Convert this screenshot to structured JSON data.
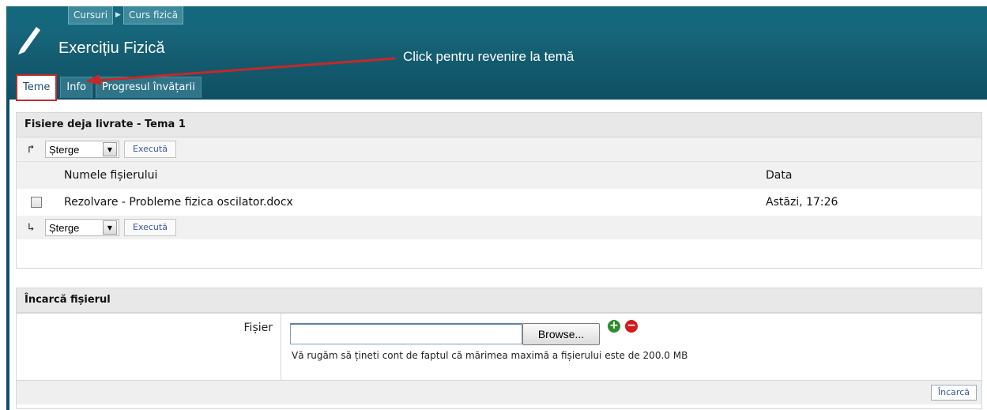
{
  "breadcrumb": [
    "Cursuri",
    "Curs fizică"
  ],
  "title": "Exercițiu Fizică",
  "annotation": "Click pentru revenire la temă",
  "tabs": [
    {
      "label": "Teme",
      "active": true
    },
    {
      "label": "Info",
      "active": false
    },
    {
      "label": "Progresul învățarii",
      "active": false
    }
  ],
  "delivered_panel": {
    "heading": "Fisiere deja livrate - Tema 1",
    "action_select": "Șterge",
    "execute_label": "Execută",
    "columns": {
      "name": "Numele fișierului",
      "date": "Data"
    },
    "files": [
      {
        "name": "Rezolvare - Probleme fizica oscilator.docx",
        "date": "Astăzi, 17:26"
      }
    ]
  },
  "upload_panel": {
    "heading": "Încarcă fișierul",
    "field_label": "Fișier",
    "browse_label": "Browse...",
    "hint": "Vă rugăm să țineti cont de faptul că mărimea maximă a fișierului este de 200.0 MB",
    "upload_label": "Încarcă"
  },
  "colors": {
    "header": "#145c70",
    "highlight": "#c62828",
    "link": "#3b5998"
  }
}
